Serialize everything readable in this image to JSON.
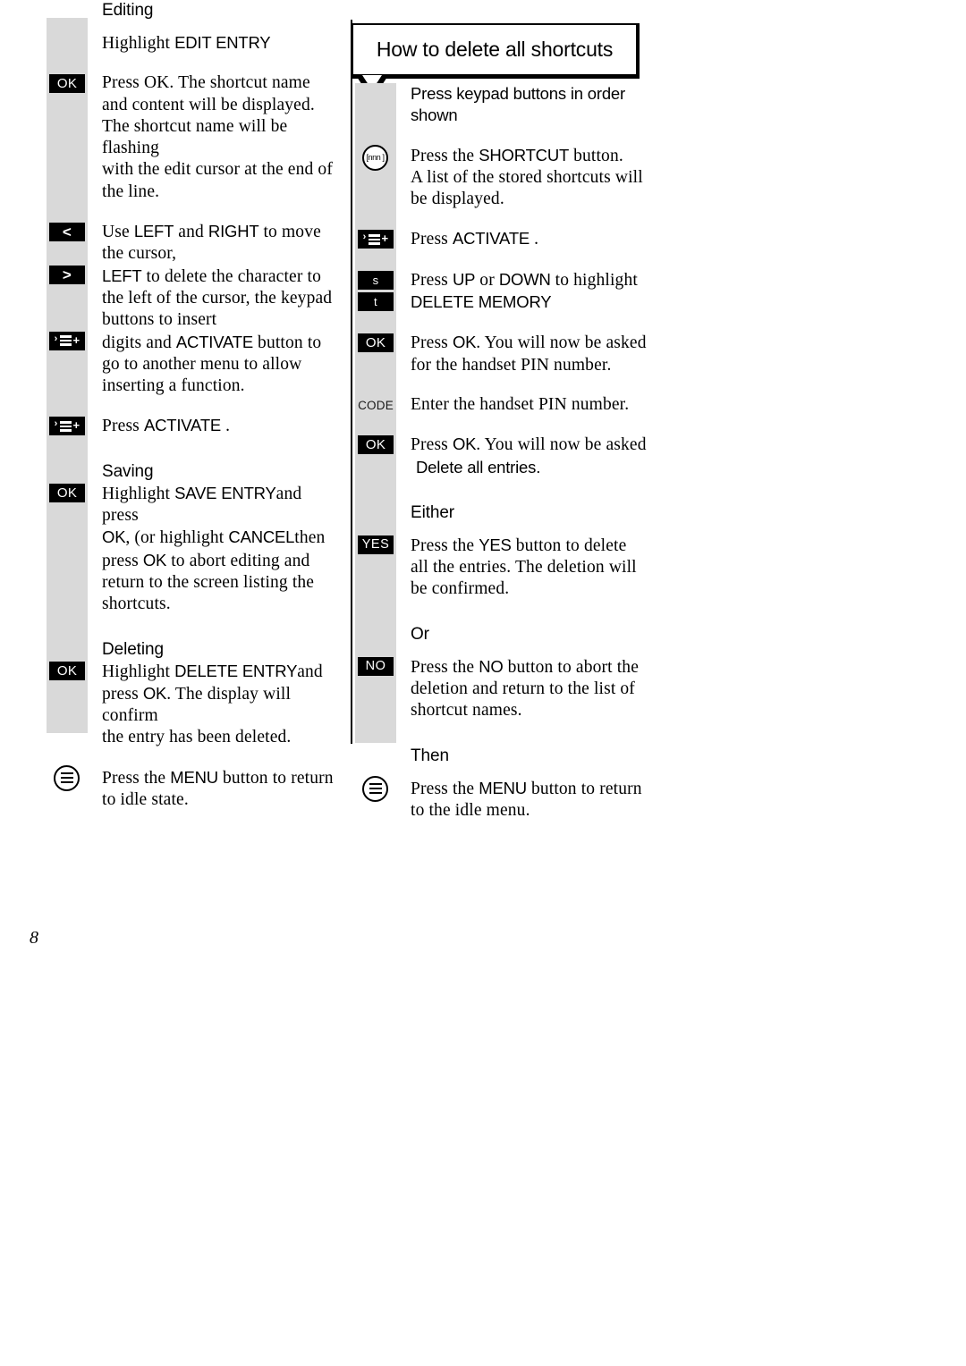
{
  "page": {
    "number": "8"
  },
  "left_column": {
    "sections": [
      {
        "heading": "Editing",
        "line_highlight_prefix": "Highlight ",
        "line_highlight_term": "EDIT ENTRY"
      }
    ],
    "blocks": {
      "ok_press": {
        "badge": "OK",
        "lines": [
          "Press OK. The shortcut name",
          "and content will be displayed.",
          "The shortcut name will be flashing",
          "with the edit cursor at the end of",
          "the line."
        ]
      },
      "cursor_move": {
        "badge": "<",
        "line1_pre": "Use ",
        "line1_term1": "LEFT",
        "line1_mid": " and ",
        "line1_term2": "RIGHT",
        "line1_post": " to move",
        "line2": "the cursor,"
      },
      "delete_char": {
        "badge": ">",
        "line1_term": "LEFT",
        "line1_post": " to delete the character to",
        "line2": "the left of the cursor, the keypad",
        "line3": "buttons to insert"
      },
      "activate_menu": {
        "badge": "activate-icon",
        "line1_pre": "digits and ",
        "line1_term": "ACTIVATE",
        "line1_post": " button to",
        "line2": "go to another menu to allow",
        "line3": "inserting a function."
      },
      "press_activate": {
        "badge": "activate-icon",
        "line_pre": "Press ",
        "line_term": "ACTIVATE",
        "line_post": " ."
      },
      "saving": {
        "heading": "Saving",
        "badge": "OK",
        "line1_pre": "Highlight ",
        "line1_term": "SAVE ENTRY",
        "line1_post": "and press",
        "line2_term1": "OK",
        "line2_mid": ", (or highlight ",
        "line2_term2": "CANCEL",
        "line2_post": "then",
        "line3_pre": "press ",
        "line3_term": "OK",
        "line3_post": " to abort editing and",
        "line4": "return to the screen listing the",
        "line5": "shortcuts."
      },
      "deleting": {
        "heading": "Deleting",
        "badge": "OK",
        "line1_pre": "Highlight ",
        "line1_term": "DELETE ENTRY",
        "line1_post": "and",
        "line2_pre": "press ",
        "line2_term": "OK",
        "line2_post": ". The display will confirm",
        "line3": "the entry has been deleted."
      },
      "menu_return": {
        "badge": "menu-key-icon",
        "line1_pre": "Press the ",
        "line1_term": "MENU",
        "line1_post": " button to return",
        "line2": "to idle state."
      }
    }
  },
  "right_column": {
    "callout_title": "How to delete all shortcuts",
    "intro": "Press keypad buttons in order shown",
    "blocks": {
      "shortcut_button": {
        "badge": "shortcut-key-icon",
        "badge_glyph": "[nnn ]",
        "line1_pre": "Press the ",
        "line1_term": "SHORTCUT",
        "line1_post": " button.",
        "line2": "A list of the stored shortcuts will",
        "line3": "be displayed."
      },
      "press_activate": {
        "badge": "activate-icon",
        "line_pre": "Press ",
        "line_term": "ACTIVATE",
        "line_post": " ."
      },
      "updown": {
        "badge_up": "s",
        "badge_down": "t",
        "line1_pre": "Press ",
        "line1_term1": "UP",
        "line1_mid": " or ",
        "line1_term2": "DOWN",
        "line1_post": " to highlight",
        "line2_term": "DELETE MEMORY"
      },
      "ok_pin": {
        "badge": "OK",
        "line1_pre": "Press ",
        "line1_term": "OK",
        "line1_post": ". You will now be asked",
        "line2": "for the handset PIN number."
      },
      "code_entry": {
        "badge": "CODE",
        "line": "Enter the handset PIN number."
      },
      "ok_confirm": {
        "badge": "OK",
        "line1_pre": "Press ",
        "line1_term": "OK",
        "line1_post": ". You will now be asked",
        "line2_term": "Delete all entries."
      },
      "either": {
        "heading": "Either",
        "badge": "YES",
        "line1_pre": "Press the ",
        "line1_term": "YES",
        "line1_post": " button to delete",
        "line2": "all the entries. The deletion will",
        "line3": "be confirmed."
      },
      "or": {
        "heading": "Or",
        "badge": "NO",
        "line1_pre": "Press the ",
        "line1_term": "NO",
        "line1_post": " button to abort the",
        "line2": "deletion and return to the list of",
        "line3": "shortcut names."
      },
      "then": {
        "heading": "Then",
        "badge": "menu-key-icon",
        "line1_pre": "Press the ",
        "line1_term": "MENU",
        "line1_post": " button to return",
        "line2": "to the idle menu."
      }
    }
  }
}
